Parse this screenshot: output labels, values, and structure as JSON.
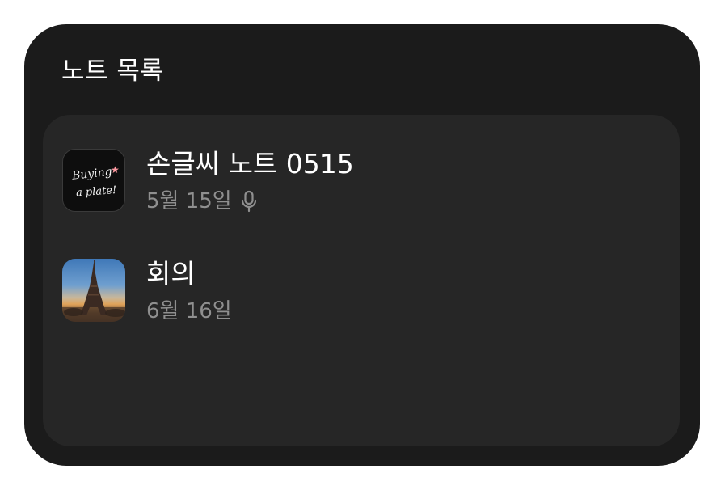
{
  "widget": {
    "title": "노트 목록"
  },
  "notes": [
    {
      "title": "손글씨 노트 0515",
      "date": "5월 15일",
      "thumbnail_text": [
        "Buying",
        "a plate!"
      ],
      "thumbnail": "handwriting-thumbnail",
      "has_voice_icon": "mic-icon"
    },
    {
      "title": "회의",
      "date": "6월 16일",
      "thumbnail": "eiffel-tower-photo-thumbnail"
    }
  ],
  "colors": {
    "widget_bg": "#1b1b1b",
    "card_bg": "#262626",
    "title_text": "#ffffff",
    "date_text": "#8f8f8f"
  }
}
